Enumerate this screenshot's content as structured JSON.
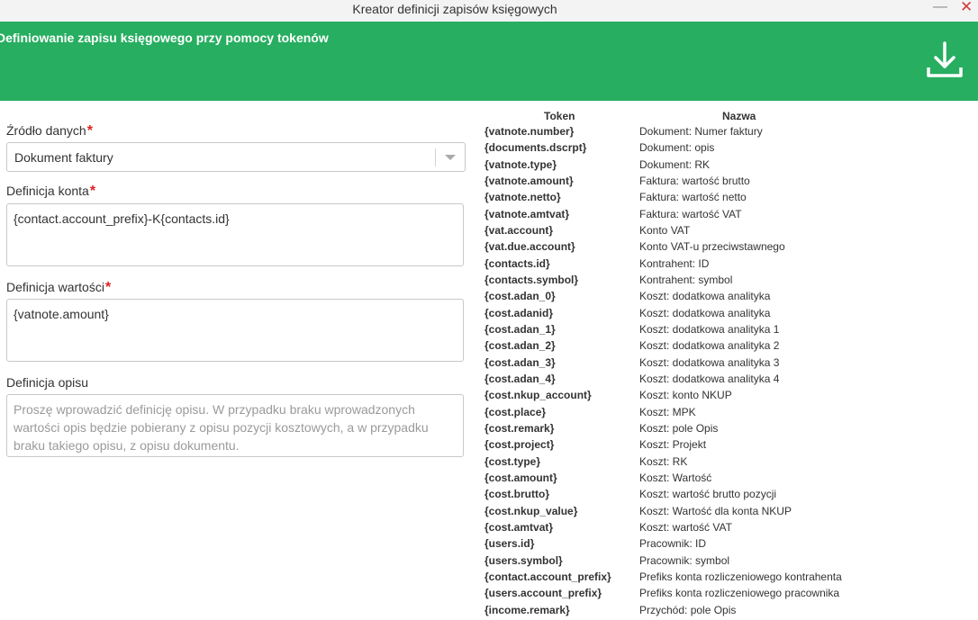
{
  "window": {
    "title": "Kreator definicji zapisów księgowych",
    "minimize_glyph": "—",
    "close_glyph": "✕"
  },
  "header": {
    "title": "Definiowanie zapisu księgowego przy pomocy tokenów",
    "download_icon": "download-icon",
    "background_color": "#27ae60"
  },
  "form": {
    "source": {
      "label": "Źródło danych",
      "required_mark": "*",
      "value": "Dokument faktury"
    },
    "account": {
      "label": "Definicja konta",
      "required_mark": "*",
      "value": "{contact.account_prefix}-K{contacts.id}"
    },
    "amount": {
      "label": "Definicja wartości",
      "required_mark": "*",
      "value": "{vatnote.amount}"
    },
    "description": {
      "label": "Definicja opisu",
      "value": "",
      "placeholder": "Proszę wprowadzić definicję opisu. W przypadku braku wprowadzonych wartości opis będzie pobierany z opisu pozycji kosztowych, a w przypadku braku takiego opisu, z opisu dokumentu."
    }
  },
  "tokens": {
    "header_token": "Token",
    "header_name": "Nazwa",
    "rows": [
      {
        "token": "{vatnote.number}",
        "name": "Dokument: Numer faktury"
      },
      {
        "token": "{documents.dscrpt}",
        "name": "Dokument: opis"
      },
      {
        "token": "{vatnote.type}",
        "name": "Dokument: RK"
      },
      {
        "token": "{vatnote.amount}",
        "name": "Faktura: wartość brutto"
      },
      {
        "token": "{vatnote.netto}",
        "name": "Faktura: wartość netto"
      },
      {
        "token": "{vatnote.amtvat}",
        "name": "Faktura: wartość VAT"
      },
      {
        "token": "{vat.account}",
        "name": "Konto VAT"
      },
      {
        "token": "{vat.due.account}",
        "name": "Konto VAT-u przeciwstawnego"
      },
      {
        "token": "{contacts.id}",
        "name": "Kontrahent: ID"
      },
      {
        "token": "{contacts.symbol}",
        "name": "Kontrahent: symbol"
      },
      {
        "token": "{cost.adan_0}",
        "name": "Koszt: dodatkowa analityka"
      },
      {
        "token": "{cost.adanid}",
        "name": "Koszt: dodatkowa analityka"
      },
      {
        "token": "{cost.adan_1}",
        "name": "Koszt: dodatkowa analityka 1"
      },
      {
        "token": "{cost.adan_2}",
        "name": "Koszt: dodatkowa analityka 2"
      },
      {
        "token": "{cost.adan_3}",
        "name": "Koszt: dodatkowa analityka 3"
      },
      {
        "token": "{cost.adan_4}",
        "name": "Koszt: dodatkowa analityka 4"
      },
      {
        "token": "{cost.nkup_account}",
        "name": "Koszt: konto NKUP"
      },
      {
        "token": "{cost.place}",
        "name": "Koszt: MPK"
      },
      {
        "token": "{cost.remark}",
        "name": "Koszt: pole Opis"
      },
      {
        "token": "{cost.project}",
        "name": "Koszt: Projekt"
      },
      {
        "token": "{cost.type}",
        "name": "Koszt: RK"
      },
      {
        "token": "{cost.amount}",
        "name": "Koszt: Wartość"
      },
      {
        "token": "{cost.brutto}",
        "name": "Koszt: wartość brutto pozycji"
      },
      {
        "token": "{cost.nkup_value}",
        "name": "Koszt: Wartość dla konta NKUP"
      },
      {
        "token": "{cost.amtvat}",
        "name": "Koszt: wartość VAT"
      },
      {
        "token": "{users.id}",
        "name": "Pracownik: ID"
      },
      {
        "token": "{users.symbol}",
        "name": "Pracownik: symbol"
      },
      {
        "token": "{contact.account_prefix}",
        "name": "Prefiks konta rozliczeniowego kontrahenta"
      },
      {
        "token": "{users.account_prefix}",
        "name": "Prefiks konta rozliczeniowego pracownika"
      },
      {
        "token": "{income.remark}",
        "name": "Przychód: pole Opis"
      }
    ]
  }
}
